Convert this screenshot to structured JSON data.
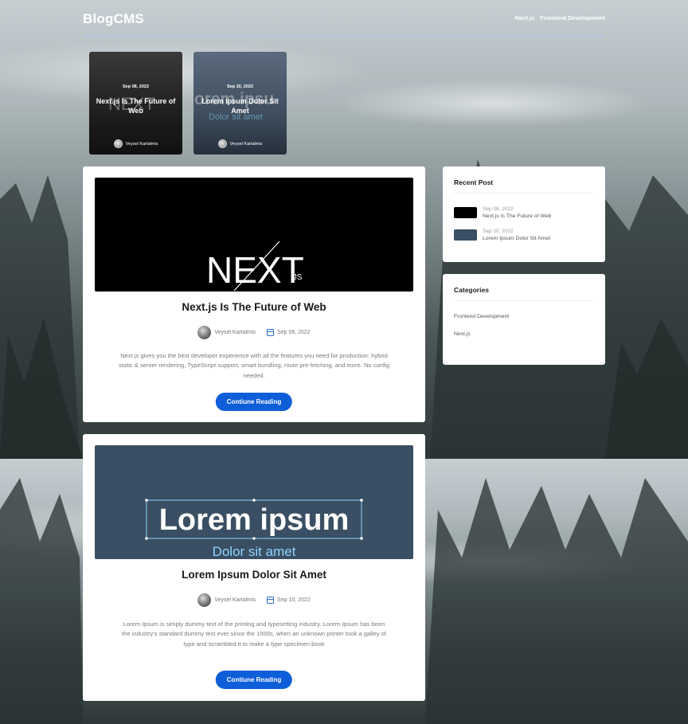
{
  "brand": "BlogCMS",
  "nav": {
    "links": [
      "Next.js",
      "Frontend Development"
    ]
  },
  "slider": [
    {
      "date": "Sep 08, 2022",
      "title": "Next.js Is The Future of Web",
      "author": "Veysel Kartalmis"
    },
    {
      "date": "Sep 10, 2022",
      "title": "Lorem Ipsum Dolor Sit Amet",
      "author": "Veysel Kartalmis"
    }
  ],
  "posts": [
    {
      "image_text": "NEXT",
      "image_sub": ".JS",
      "title": "Next.js Is The Future of Web",
      "author": "Veysel Kartalmis",
      "date": "Sep 08, 2022",
      "excerpt": "Next.js gives you the best developer experience with all the features you need for production: hybrid static & server rendering, TypeScript support, smart bundling, route pre-fetching, and more. No config needed.",
      "button": "Contiune Reading"
    },
    {
      "image_text": "Lorem ipsum",
      "image_sub": "Dolor sit amet",
      "title": "Lorem Ipsum Dolor Sit Amet",
      "author": "Veysel Kartalmis",
      "date": "Sep 10, 2022",
      "excerpt": "Lorem Ipsum is simply dummy text of the printing and typesetting industry. Lorem Ipsum has been the industry's standard dummy text ever since the 1500s, when an unknown printer took a galley of type and scrambled it to make a type specimen book",
      "button": "Contiune Reading"
    }
  ],
  "recent": {
    "title": "Recent Post",
    "items": [
      {
        "date": "Sep 08, 2022",
        "title": "Next.js Is The Future of Web"
      },
      {
        "date": "Sep 10, 2022",
        "title": "Lorem Ipsum Dolor Sit Amet"
      }
    ]
  },
  "categories": {
    "title": "Categories",
    "items": [
      "Frontend Development",
      "Next.js"
    ]
  },
  "colors": {
    "accent": "#0d5ed8",
    "card": "#ffffff",
    "lorem_bg": "#3a4f63"
  }
}
